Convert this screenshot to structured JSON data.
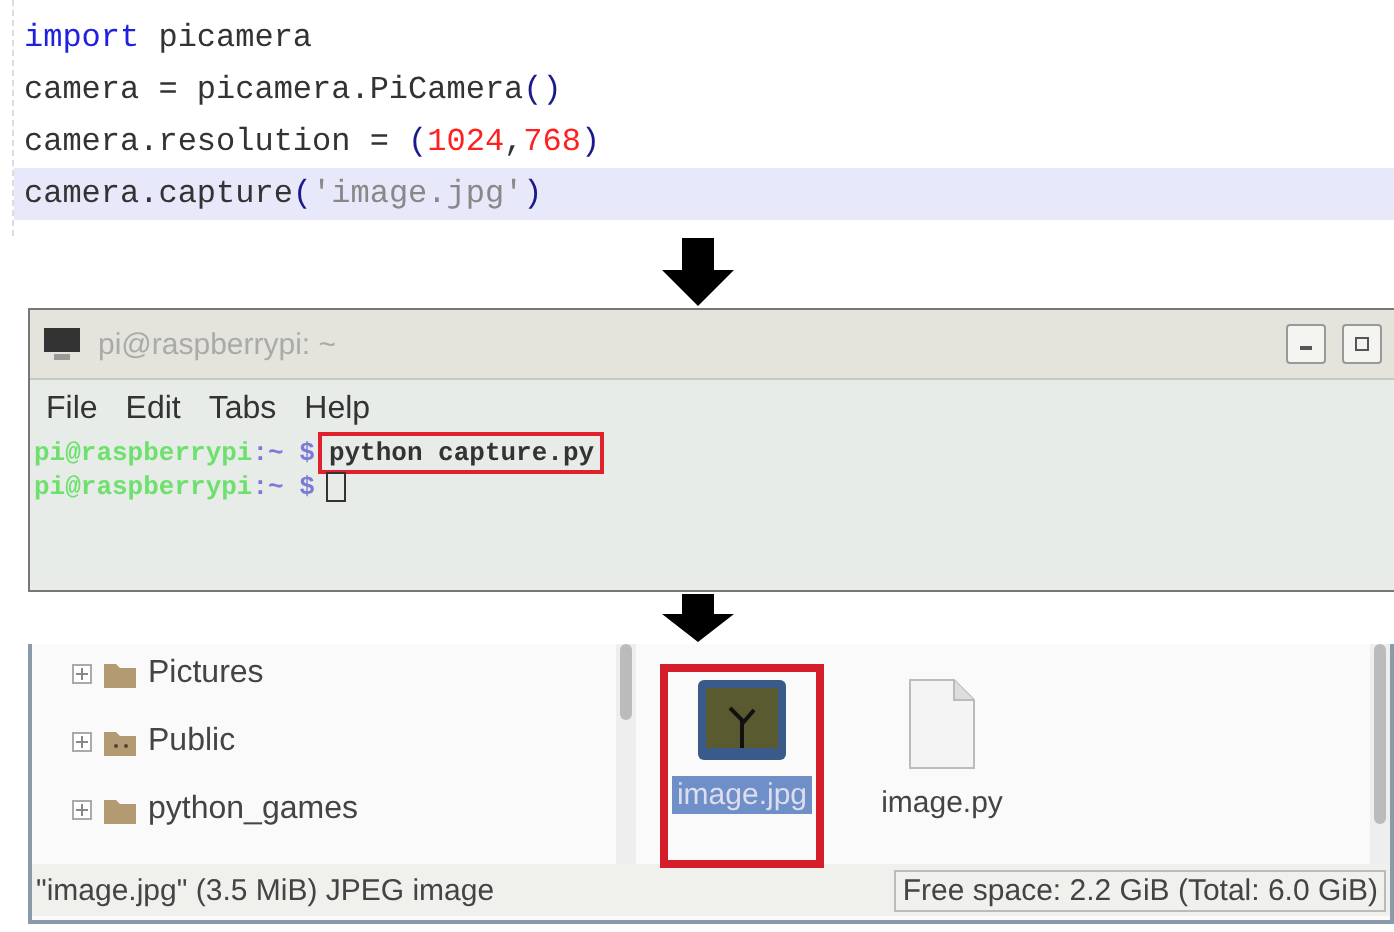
{
  "code_editor": {
    "lines": [
      {
        "highlighted": false,
        "tokens": [
          {
            "text": "import",
            "kind": "keyword"
          },
          {
            "text": " picamera",
            "kind": "plain"
          }
        ]
      },
      {
        "highlighted": false,
        "tokens": [
          {
            "text": "camera = picamera.PiCamera",
            "kind": "plain"
          },
          {
            "text": "()",
            "kind": "paren"
          }
        ]
      },
      {
        "highlighted": false,
        "tokens": [
          {
            "text": "camera.resolution = ",
            "kind": "plain"
          },
          {
            "text": "(",
            "kind": "paren"
          },
          {
            "text": "1024",
            "kind": "number"
          },
          {
            "text": ",",
            "kind": "plain"
          },
          {
            "text": "768",
            "kind": "number"
          },
          {
            "text": ")",
            "kind": "paren"
          }
        ]
      },
      {
        "highlighted": true,
        "tokens": [
          {
            "text": "camera.capture",
            "kind": "plain"
          },
          {
            "text": "(",
            "kind": "paren"
          },
          {
            "text": "'image.jpg'",
            "kind": "string"
          },
          {
            "text": ")",
            "kind": "paren"
          }
        ]
      }
    ]
  },
  "terminal": {
    "title": "pi@raspberrypi: ~",
    "menu": [
      "File",
      "Edit",
      "Tabs",
      "Help"
    ],
    "lines": [
      {
        "kind": "command",
        "user": "pi@raspberrypi",
        "path": ":~ $",
        "command": "python capture.py",
        "boxed": true
      },
      {
        "kind": "input",
        "user": "pi@raspberrypi",
        "path": ":~ $",
        "cursor": true
      }
    ]
  },
  "file_manager": {
    "tree": [
      {
        "label": "Pictures",
        "kind": "folder"
      },
      {
        "label": "Public",
        "kind": "public"
      },
      {
        "label": "python_games",
        "kind": "folder"
      }
    ],
    "files": [
      {
        "name": "image.jpg",
        "kind": "image",
        "selected": true,
        "boxed": true
      },
      {
        "name": "image.py",
        "kind": "document",
        "selected": false,
        "boxed": false
      }
    ],
    "status_left": "\"image.jpg\" (3.5 MiB) JPEG image",
    "status_right": "Free space: 2.2 GiB (Total: 6.0 GiB)"
  }
}
